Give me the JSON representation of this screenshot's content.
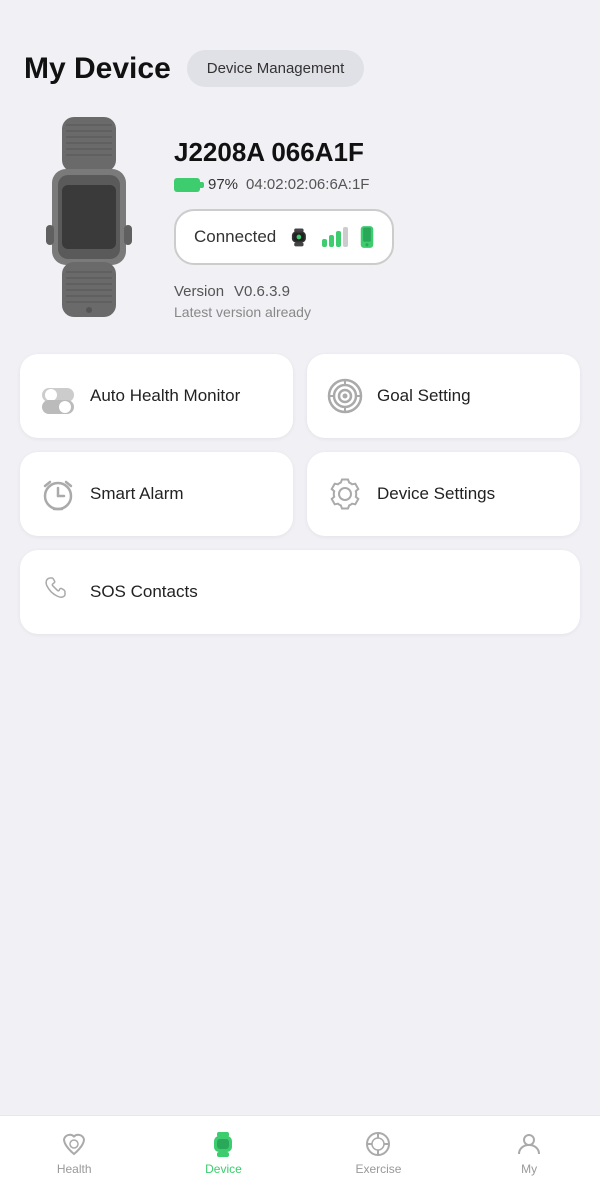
{
  "header": {
    "title": "My Device",
    "management_btn": "Device Management"
  },
  "device": {
    "name": "J2208A 066A1F",
    "battery_percent": "97%",
    "mac_address": "04:02:02:06:6A:1F",
    "connection_status": "Connected",
    "version_label": "Version",
    "version_value": "V0.6.3.9",
    "version_sub": "Latest version already"
  },
  "menu": {
    "items": [
      {
        "id": "auto-health-monitor",
        "label": "Auto Health Monitor",
        "icon": "toggle-icon"
      },
      {
        "id": "goal-setting",
        "label": "Goal Setting",
        "icon": "target-icon"
      },
      {
        "id": "smart-alarm",
        "label": "Smart Alarm",
        "icon": "alarm-icon"
      },
      {
        "id": "device-settings",
        "label": "Device Settings",
        "icon": "gear-icon"
      },
      {
        "id": "sos-contacts",
        "label": "SOS Contacts",
        "icon": "phone-icon",
        "full": true
      }
    ]
  },
  "nav": {
    "items": [
      {
        "id": "health",
        "label": "Health",
        "active": false
      },
      {
        "id": "device",
        "label": "Device",
        "active": true
      },
      {
        "id": "exercise",
        "label": "Exercise",
        "active": false
      },
      {
        "id": "my",
        "label": "My",
        "active": false
      }
    ]
  }
}
